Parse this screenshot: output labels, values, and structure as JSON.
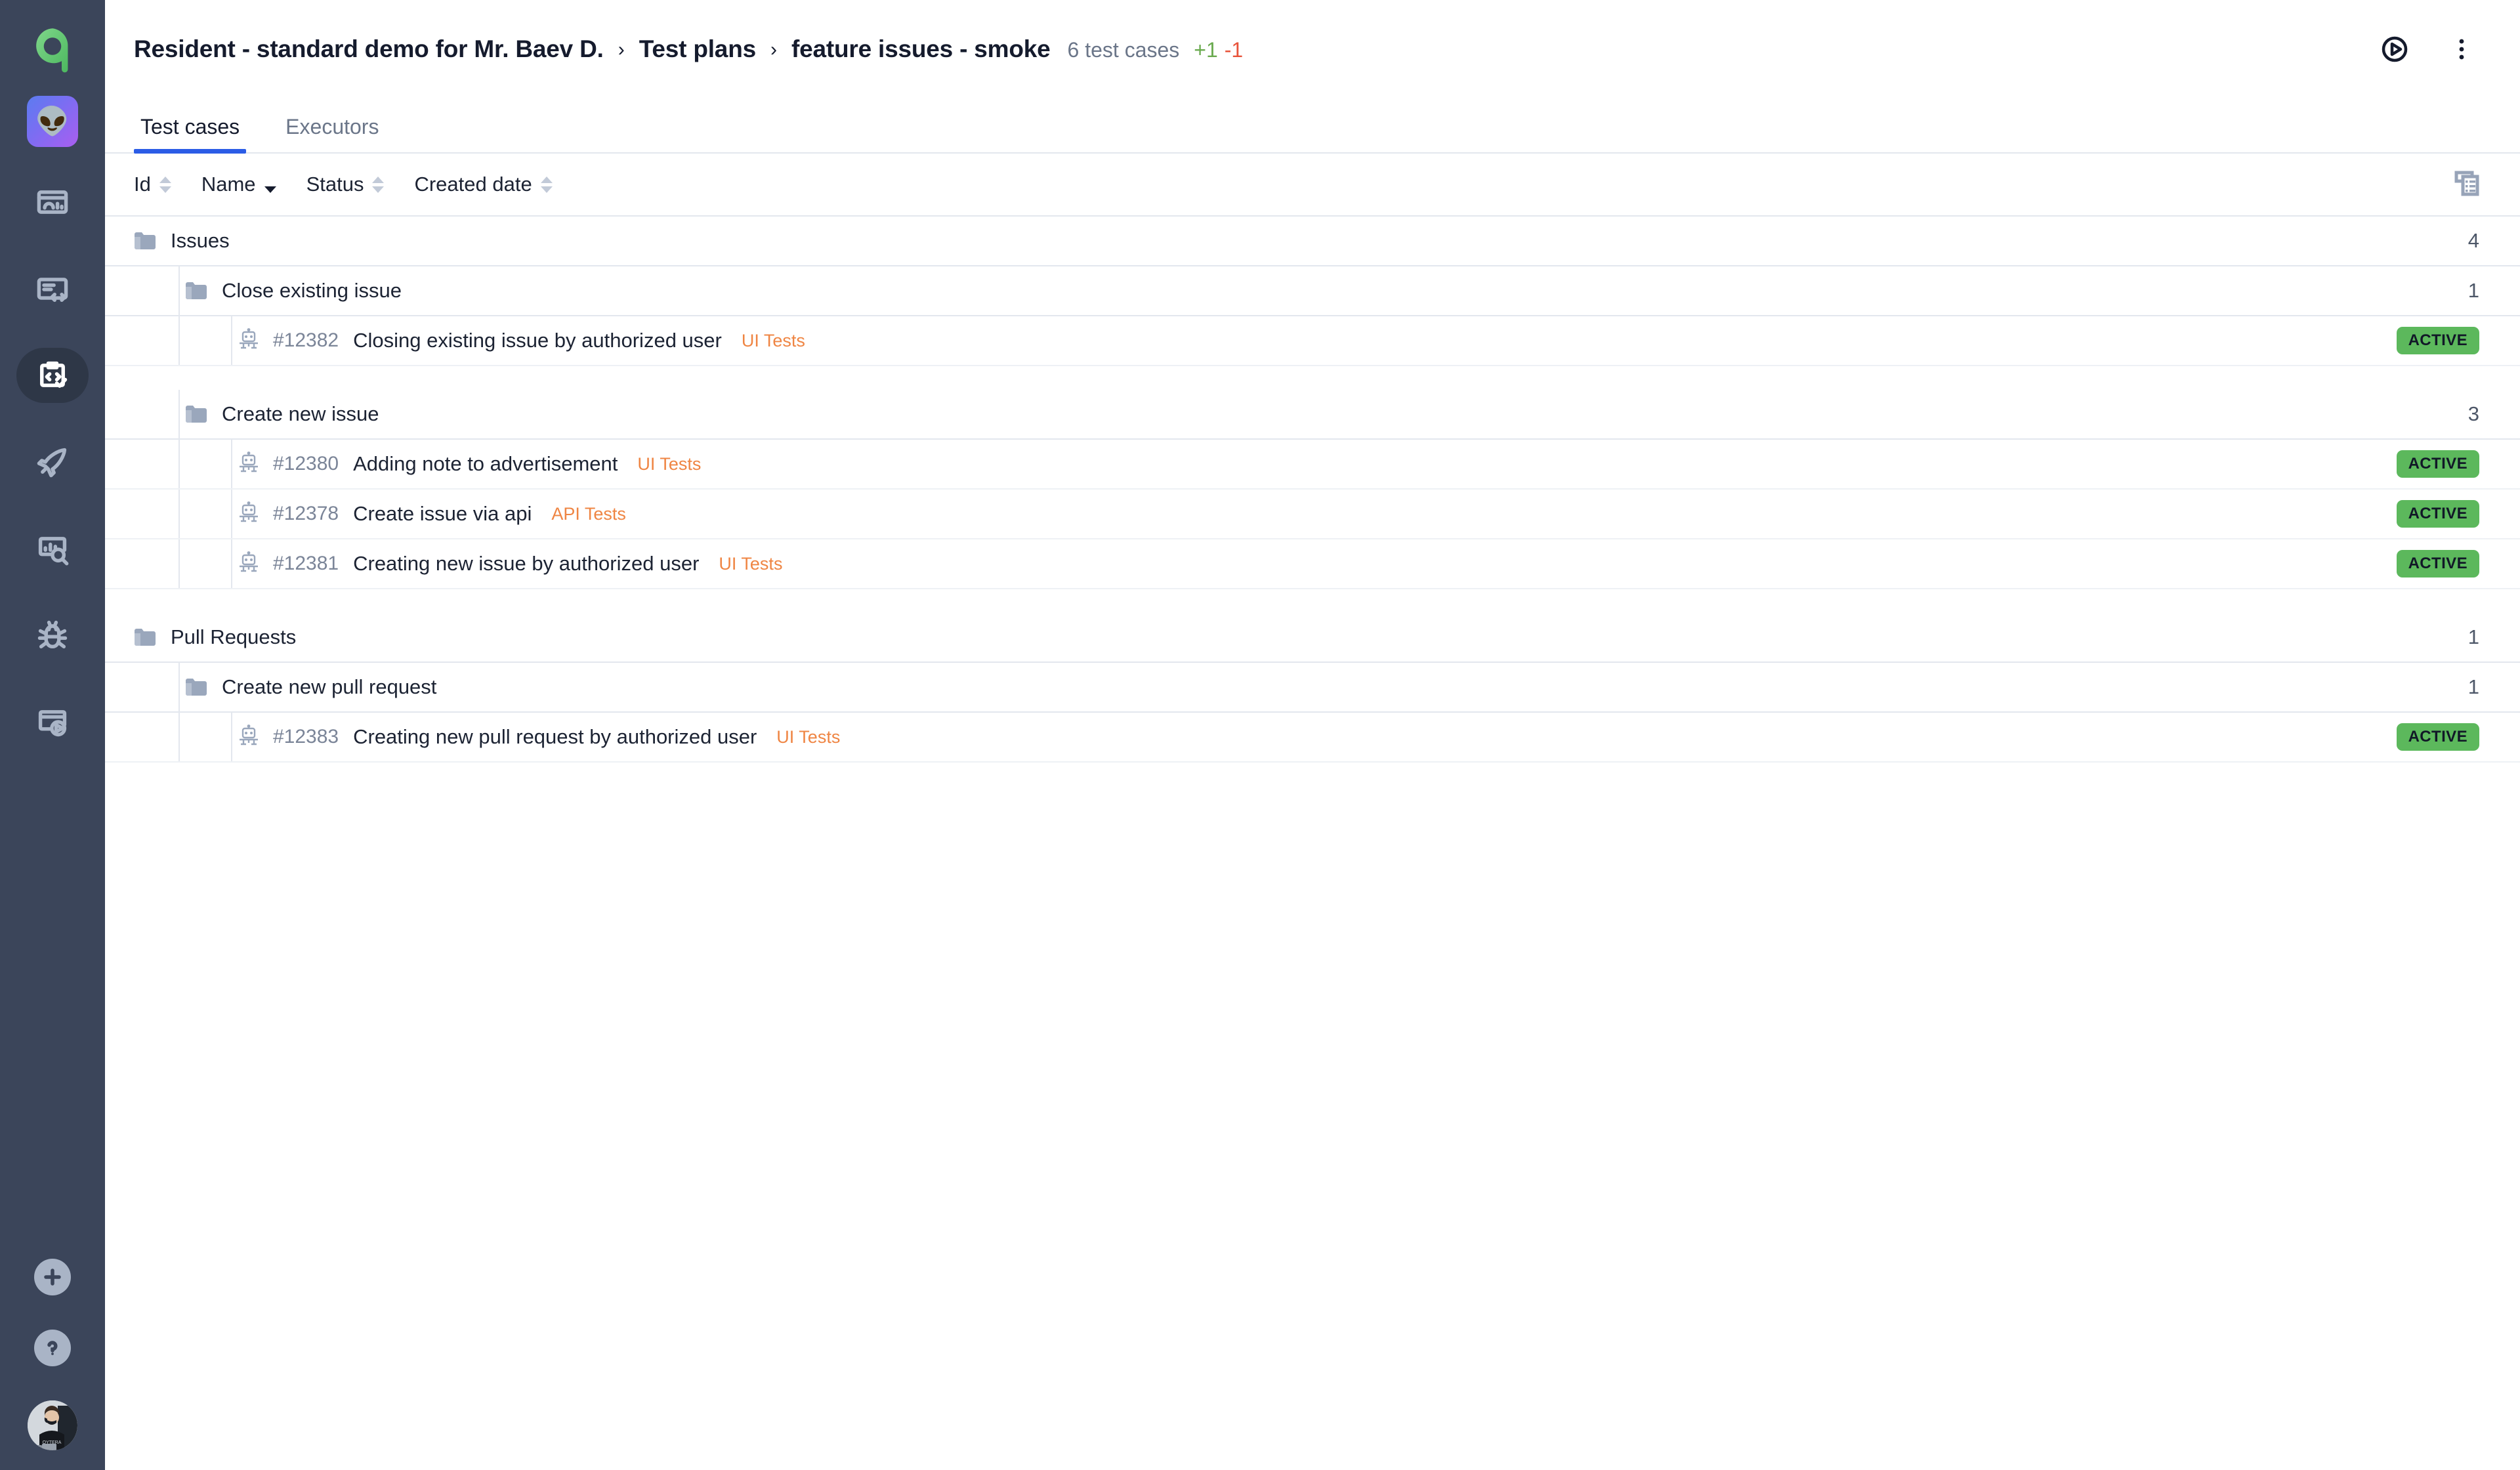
{
  "sidebar": {
    "logo": {
      "name": "allure-logo",
      "color": "#62c370"
    },
    "project_badge": {
      "emoji": "👽",
      "name": "project-avatar"
    },
    "nav_items": [
      {
        "icon": "dashboard-icon",
        "label": "Dashboards",
        "active": false
      },
      {
        "icon": "code-report-icon",
        "label": "Reports",
        "active": false
      },
      {
        "icon": "test-plans-icon",
        "label": "Test plans",
        "active": true
      },
      {
        "icon": "rocket-icon",
        "label": "Launches",
        "active": false
      },
      {
        "icon": "analytics-search-icon",
        "label": "Analytics",
        "active": false
      },
      {
        "icon": "bug-icon",
        "label": "Defects",
        "active": false
      },
      {
        "icon": "video-player-icon",
        "label": "Sessions",
        "active": false
      }
    ],
    "bottom": [
      {
        "icon": "plus-icon",
        "label": "Create"
      },
      {
        "icon": "question-icon",
        "label": "Help"
      },
      {
        "icon": "user-avatar",
        "label": "User profile"
      }
    ]
  },
  "header": {
    "breadcrumbs": [
      "Resident - standard demo for Mr. Baev D.",
      "Test plans",
      "feature issues - smoke"
    ],
    "separator": "›",
    "test_case_count": "6 test cases",
    "delta_plus": "+1",
    "delta_minus": "-1",
    "actions": [
      {
        "icon": "play-circle-icon",
        "label": "Run"
      },
      {
        "icon": "more-vertical-icon",
        "label": "More options"
      }
    ]
  },
  "tabs": [
    {
      "label": "Test cases",
      "active": true
    },
    {
      "label": "Executors",
      "active": false
    }
  ],
  "table": {
    "columns": [
      {
        "label": "Id",
        "sort": "none"
      },
      {
        "label": "Name",
        "sort": "desc"
      },
      {
        "label": "Status",
        "sort": "none"
      },
      {
        "label": "Created date",
        "sort": "none"
      }
    ],
    "columns_toggle_icon": "columns-view-icon"
  },
  "tree": {
    "groups": [
      {
        "name": "Issues",
        "count": "4",
        "subgroups": [
          {
            "name": "Close existing issue",
            "count": "1",
            "cases": [
              {
                "id": "#12382",
                "name": "Closing existing issue by authorized user",
                "tag": "UI Tests",
                "status": "ACTIVE"
              }
            ]
          },
          {
            "name": "Create new issue",
            "count": "3",
            "cases": [
              {
                "id": "#12380",
                "name": "Adding note to advertisement",
                "tag": "UI Tests",
                "status": "ACTIVE"
              },
              {
                "id": "#12378",
                "name": "Create issue via api",
                "tag": "API Tests",
                "status": "ACTIVE"
              },
              {
                "id": "#12381",
                "name": "Creating new issue by authorized user",
                "tag": "UI Tests",
                "status": "ACTIVE"
              }
            ]
          }
        ]
      },
      {
        "name": "Pull Requests",
        "count": "1",
        "subgroups": [
          {
            "name": "Create new pull request",
            "count": "1",
            "cases": [
              {
                "id": "#12383",
                "name": "Creating new pull request by authorized user",
                "tag": "UI Tests",
                "status": "ACTIVE"
              }
            ]
          }
        ]
      }
    ]
  },
  "colors": {
    "sidebar_bg": "#3b455a",
    "accent_blue": "#2b5ce6",
    "tag_orange": "#ef8543",
    "badge_green": "#5cb85c",
    "delta_plus_green": "#6aaa4f",
    "delta_minus_red": "#e8533a"
  }
}
